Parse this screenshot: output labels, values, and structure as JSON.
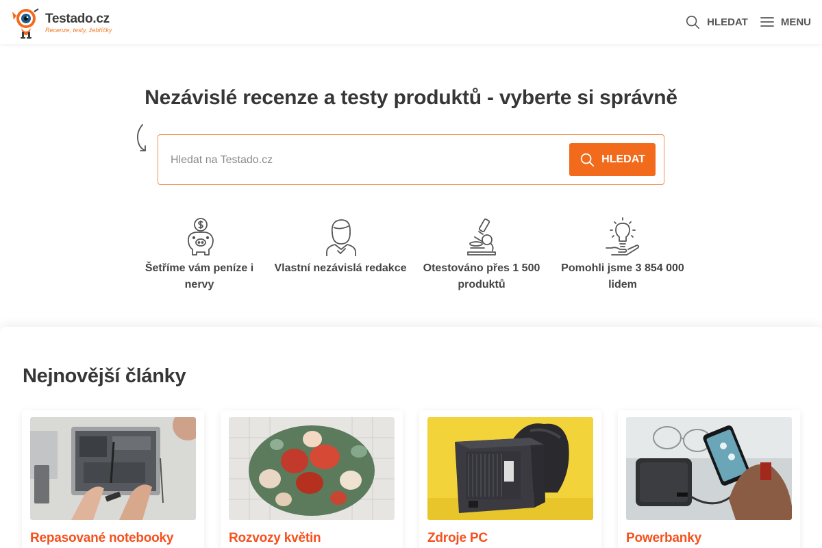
{
  "header": {
    "logo": {
      "name": "Testado.cz",
      "tagline": "Recenze, testy, žebříčky"
    },
    "search_label": "HLEDAT",
    "menu_label": "MENU"
  },
  "hero": {
    "title": "Nezávislé recenze a testy produktů - vyberte si správně",
    "search": {
      "placeholder": "Hledat na Testado.cz",
      "value": "",
      "button_label": "HLEDAT"
    }
  },
  "features": [
    {
      "icon": "piggy-bank-icon",
      "label": "Šetříme vám peníze i nervy"
    },
    {
      "icon": "editor-person-icon",
      "label": "Vlastní nezávislá redakce"
    },
    {
      "icon": "microscope-icon",
      "label": "Otestováno přes 1 500 produktů"
    },
    {
      "icon": "lightbulb-hand-icon",
      "label": "Pomohli jsme 3 854 000 lidem"
    }
  ],
  "articles": {
    "title": "Nejnovější články",
    "items": [
      {
        "title": "Repasované notebooky",
        "image": "laptop-repair-photo"
      },
      {
        "title": "Rozvozy květin",
        "image": "flower-bouquet-photo"
      },
      {
        "title": "Zdroje PC",
        "image": "pc-power-supply-photo"
      },
      {
        "title": "Powerbanky",
        "image": "powerbank-phone-photo"
      }
    ]
  },
  "colors": {
    "accent": "#f26b1d",
    "link": "#f4511e",
    "text": "#363636"
  }
}
